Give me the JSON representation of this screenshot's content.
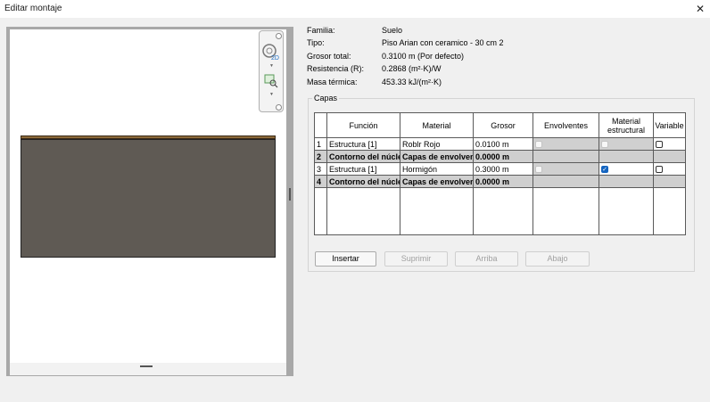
{
  "window": {
    "title": "Editar montaje",
    "close_glyph": "✕"
  },
  "navbar": {
    "top_icon": "view-cube-icon",
    "badge_2d": "2D",
    "zoom_icon": "zoom-region-icon"
  },
  "properties": [
    {
      "label": "Familia:",
      "value": "Suelo"
    },
    {
      "label": "Tipo:",
      "value": "Piso Arian con ceramico - 30 cm 2"
    },
    {
      "label": "Grosor total:",
      "value": "0.3100 m (Por defecto)"
    },
    {
      "label": "Resistencia (R):",
      "value": "0.2868 (m²·K)/W"
    },
    {
      "label": "Masa térmica:",
      "value": "453.33 kJ/(m²·K)"
    }
  ],
  "layers": {
    "group_label": "Capas",
    "columns": {
      "funcion": "Función",
      "material": "Material",
      "grosor": "Grosor",
      "envolventes": "Envolventes",
      "material_estructural_1": "Material",
      "material_estructural_2": "estructural",
      "variable": "Variable"
    },
    "rows": [
      {
        "num": "1",
        "funcion": "Estructura [1]",
        "material": "Roblr Rojo",
        "grosor": "0.0100 m",
        "envolventes": false,
        "estructural": false,
        "variable": false
      },
      {
        "num": "2",
        "funcion": "Contorno del núcleo",
        "material": "Capas de envolvente",
        "grosor": "0.0000 m"
      },
      {
        "num": "3",
        "funcion": "Estructura [1]",
        "material": "Hormigón",
        "grosor": "0.3000 m",
        "envolventes": false,
        "estructural": true,
        "variable": false
      },
      {
        "num": "4",
        "funcion": "Contorno del núcleo",
        "material": "Capas de envolvente",
        "grosor": "0.0000 m"
      }
    ]
  },
  "buttons": {
    "insertar": "Insertar",
    "suprimir": "Suprimir",
    "arriba": "Arriba",
    "abajo": "Abajo"
  },
  "colors": {
    "finish_layer": "#8c6a3a",
    "structure_layer": "#5f5a54",
    "checkbox_checked": "#1565c0"
  }
}
